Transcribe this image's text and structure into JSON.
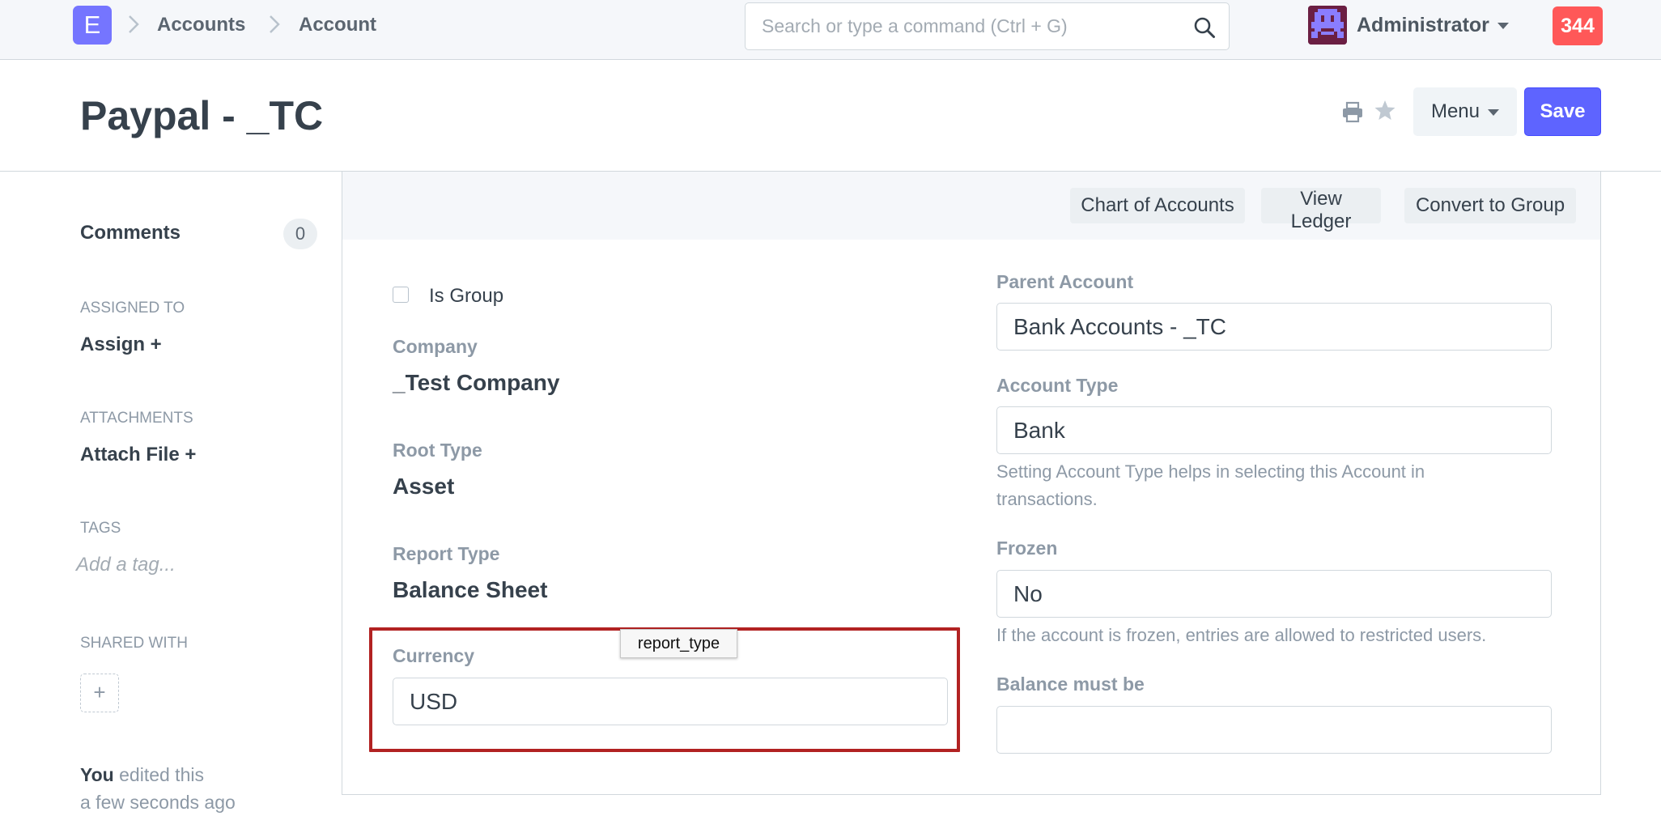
{
  "navbar": {
    "logo_letter": "E",
    "breadcrumbs": [
      "Accounts",
      "Account"
    ],
    "search_placeholder": "Search or type a command (Ctrl + G)",
    "user_name": "Administrator",
    "notification_count": "344"
  },
  "page": {
    "title": "Paypal - _TC",
    "menu_label": "Menu",
    "save_label": "Save"
  },
  "sidebar": {
    "comments_label": "Comments",
    "comments_count": "0",
    "assigned_to_heading": "ASSIGNED TO",
    "assign_label": "Assign +",
    "attachments_heading": "ATTACHMENTS",
    "attach_label": "Attach File +",
    "tags_heading": "TAGS",
    "tag_placeholder": "Add a tag...",
    "shared_with_heading": "SHARED WITH",
    "share_add": "+",
    "timeline_user": "You",
    "timeline_action": " edited this",
    "timeline_time": "a few seconds ago"
  },
  "form": {
    "toolbar_buttons": [
      "Chart of Accounts",
      "View Ledger",
      "Convert to Group"
    ],
    "is_group_label": "Is Group",
    "company_label": "Company",
    "company_value": "_Test Company",
    "root_type_label": "Root Type",
    "root_type_value": "Asset",
    "report_type_label": "Report Type",
    "report_type_value": "Balance Sheet",
    "currency_label": "Currency",
    "currency_value": "USD",
    "tooltip_text": "report_type",
    "parent_account_label": "Parent Account",
    "parent_account_value": "Bank Accounts - _TC",
    "account_type_label": "Account Type",
    "account_type_value": "Bank",
    "account_type_help": "Setting Account Type helps in selecting this Account in transactions.",
    "frozen_label": "Frozen",
    "frozen_value": "No",
    "frozen_help": "If the account is frozen, entries are allowed to restricted users.",
    "balance_label": "Balance must be",
    "balance_value": ""
  },
  "colors": {
    "accent": "#5e64ff",
    "notification": "#ff5858",
    "highlight_border": "#b22222"
  }
}
